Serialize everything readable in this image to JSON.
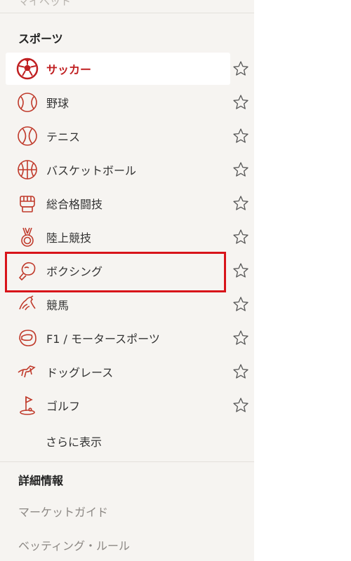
{
  "top_cut_label": "マイベット",
  "sports": {
    "title": "スポーツ",
    "items": [
      {
        "label": "サッカー",
        "icon": "soccer-ball-icon",
        "active": true
      },
      {
        "label": "野球",
        "icon": "baseball-icon",
        "active": false
      },
      {
        "label": "テニス",
        "icon": "tennis-ball-icon",
        "active": false
      },
      {
        "label": "バスケットボール",
        "icon": "basketball-icon",
        "active": false
      },
      {
        "label": "総合格闘技",
        "icon": "mma-glove-icon",
        "active": false
      },
      {
        "label": "陸上競技",
        "icon": "medal-icon",
        "active": false
      },
      {
        "label": "ボクシング",
        "icon": "boxing-glove-icon",
        "active": false
      },
      {
        "label": "競馬",
        "icon": "horse-icon",
        "active": false
      },
      {
        "label": "F1 / モータースポーツ",
        "icon": "helmet-icon",
        "active": false
      },
      {
        "label": "ドッグレース",
        "icon": "greyhound-icon",
        "active": false
      },
      {
        "label": "ゴルフ",
        "icon": "golf-flag-icon",
        "active": false
      }
    ],
    "more_label": "さらに表示"
  },
  "details": {
    "title": "詳細情報",
    "links": [
      "マーケットガイド",
      "ベッティング・ルール"
    ]
  },
  "colors": {
    "accent": "#c01f21",
    "highlight_border": "#d8141a",
    "panel_bg": "#f6f4f1"
  }
}
